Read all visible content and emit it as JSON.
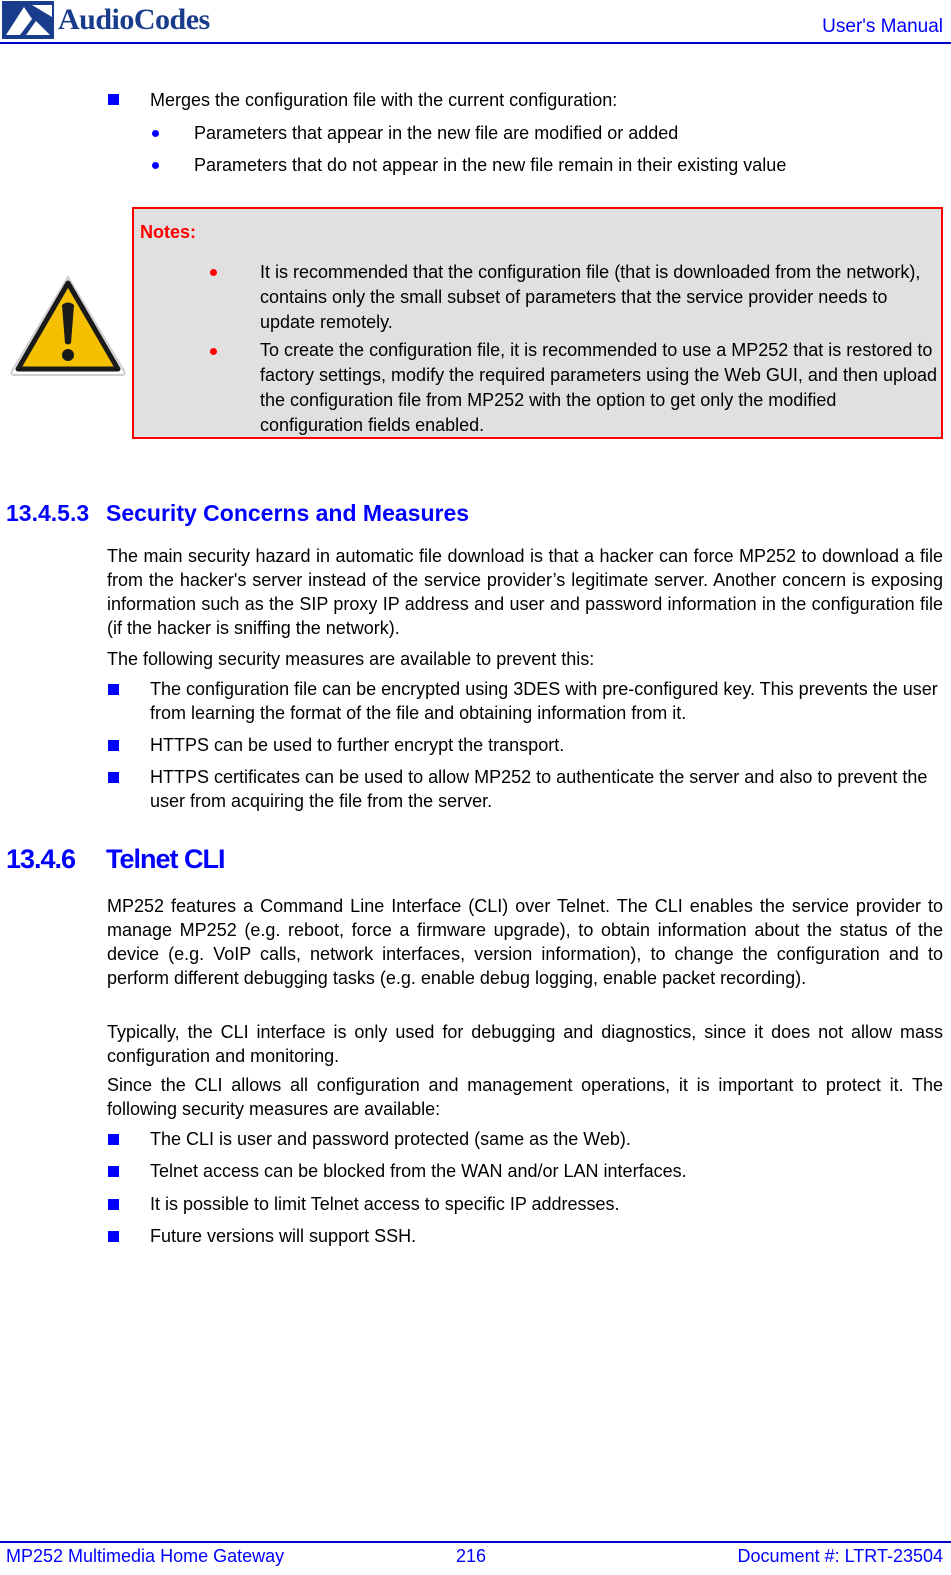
{
  "header": {
    "logo_text": "AudioCodes",
    "title": "User's Manual"
  },
  "intro_list": {
    "item": "Merges the configuration file with the current configuration:",
    "sub_items": [
      "Parameters that appear in the new file are modified or added",
      "Parameters that do not appear in the new file remain in their existing value"
    ]
  },
  "notes": {
    "icon": "warning-triangle-icon",
    "title": "Notes:",
    "items": [
      "It is recommended that the configuration file (that is downloaded from the network), contains only the small subset of parameters that the service provider needs to update remotely.",
      "To create the configuration file, it is recommended to use a MP252 that is restored to factory settings, modify the required parameters using the Web GUI, and then upload the configuration file from MP252 with the option to get only the modified configuration fields enabled."
    ]
  },
  "section_security": {
    "number": "13.4.5.3",
    "title": "Security Concerns and Measures",
    "paragraphs": [
      "The main security hazard in automatic file download is that a hacker can force MP252 to download a file from the hacker's server instead of the service provider’s legitimate server. Another concern is exposing information such as the SIP proxy IP address and user and password information in the configuration file (if the hacker is sniffing the network).",
      "The following security measures are available to prevent this:"
    ],
    "bullets": [
      "The configuration file can be encrypted using 3DES with pre-configured key. This prevents the user from learning the format of the file and obtaining information from it.",
      "HTTPS can be used to further encrypt the transport.",
      "HTTPS certificates can be used to allow MP252 to authenticate the server and also to prevent the user from acquiring the file from the server."
    ]
  },
  "section_telnet": {
    "number": "13.4.6",
    "title": "Telnet CLI",
    "paragraphs": [
      "MP252 features a Command Line Interface (CLI) over Telnet. The CLI enables the service provider to manage MP252 (e.g. reboot, force a firmware upgrade), to obtain information about the status of the device (e.g. VoIP calls, network interfaces, version information), to change the configuration and to perform different debugging tasks (e.g. enable debug logging, enable packet recording).",
      "Typically, the CLI interface is only used for debugging and diagnostics, since it does not allow mass configuration and monitoring.",
      "Since the CLI allows all configuration and management operations, it is important to protect it. The following security measures are available:"
    ],
    "bullets": [
      "The CLI is user and password protected (same as the Web).",
      "Telnet access can be blocked from the WAN and/or LAN interfaces.",
      "It is possible to limit Telnet access to specific IP addresses.",
      "Future versions will support SSH."
    ]
  },
  "footer": {
    "product": "MP252 Multimedia Home Gateway",
    "page_number": "216",
    "document": "Document #: LTRT-23504"
  },
  "colors": {
    "accent_blue": "#0000ff",
    "logo_blue": "#1a3c8c",
    "note_red": "#ff0000",
    "note_bg": "#e0e0e0",
    "warning_yellow": "#f5c000"
  }
}
